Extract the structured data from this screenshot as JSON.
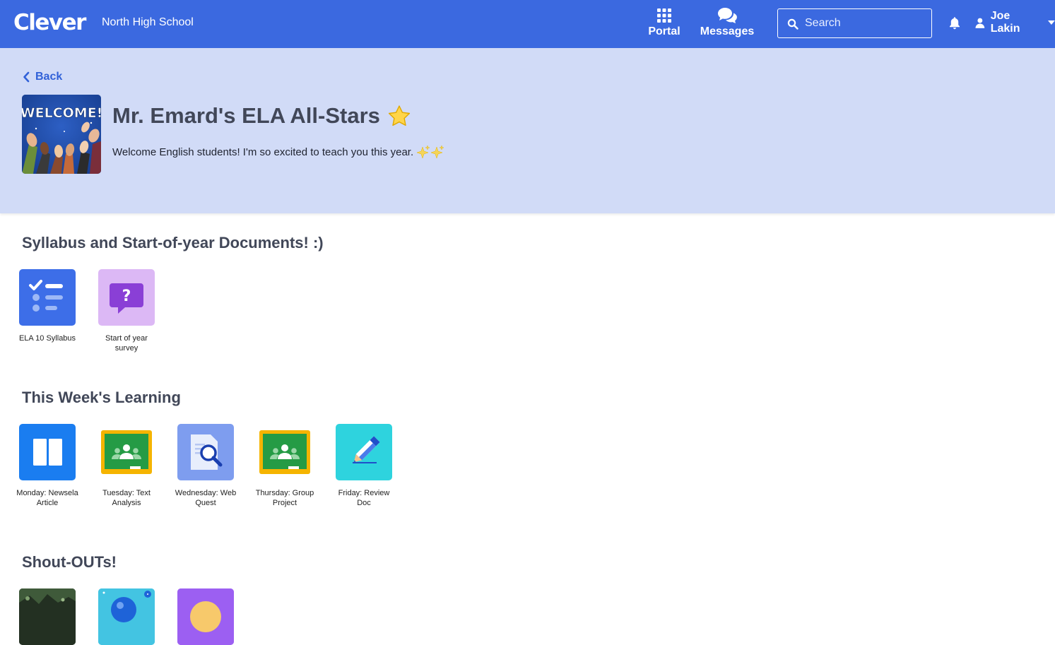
{
  "header": {
    "logo": "Clever",
    "school": "North High School",
    "nav": [
      {
        "label": "Portal",
        "icon": "grid-icon"
      },
      {
        "label": "Messages",
        "icon": "chat-bubbles-icon"
      }
    ],
    "search": {
      "placeholder": "Search",
      "value": ""
    },
    "user": {
      "name": "Joe Lakin"
    }
  },
  "banner": {
    "back_label": "Back",
    "image_text": "WELCOME!",
    "title": "Mr. Emard's ELA All-Stars",
    "description": "Welcome English students! I'm so excited to teach you this year."
  },
  "sections": [
    {
      "title": "Syllabus and Start-of-year Documents! :)",
      "items": [
        {
          "label": "ELA 10 Syllabus",
          "icon": "checklist-icon"
        },
        {
          "label": "Start of year survey",
          "icon": "question-bubble-icon"
        }
      ]
    },
    {
      "title": "This Week's Learning",
      "items": [
        {
          "label": "Monday: Newsela Article",
          "icon": "newsela-book-icon"
        },
        {
          "label": "Tuesday: Text Analysis",
          "icon": "google-classroom-icon"
        },
        {
          "label": "Wednesday: Web Quest",
          "icon": "document-search-icon"
        },
        {
          "label": "Thursday: Group Project",
          "icon": "google-classroom-icon"
        },
        {
          "label": "Friday: Review Doc",
          "icon": "pencil-icon"
        }
      ]
    },
    {
      "title": "Shout-OUTs!",
      "items": [
        {
          "label": "",
          "icon": "photo-thumbnail-icon"
        },
        {
          "label": "",
          "icon": "balloon-thumbnail-icon"
        },
        {
          "label": "",
          "icon": "emoji-thumbnail-icon"
        }
      ]
    }
  ],
  "colors": {
    "topbar": "#3B69E0",
    "band": "#D1DBF7",
    "link": "#3161D8",
    "heading": "#414758"
  }
}
